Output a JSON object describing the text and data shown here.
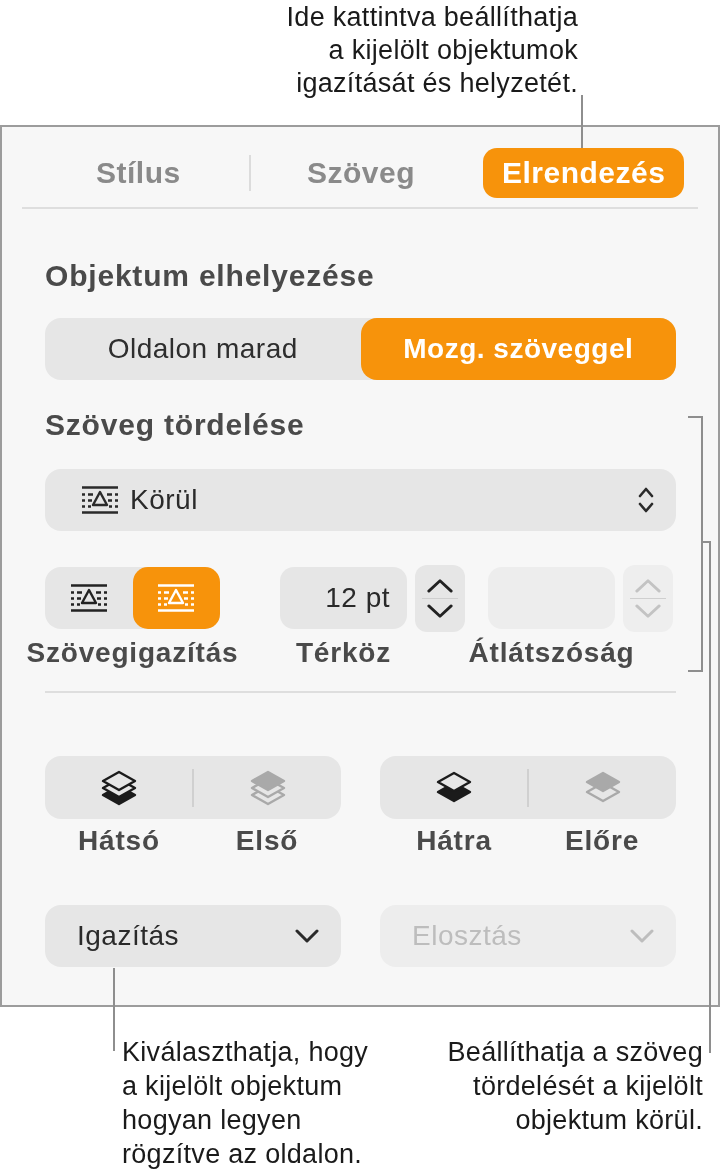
{
  "top_callout": {
    "lines": [
      "Ide kattintva beállíthatja",
      "a kijelölt objektumok",
      "igazítását és helyzetét."
    ]
  },
  "tabs": [
    {
      "label": "Stílus",
      "selected": false
    },
    {
      "label": "Szöveg",
      "selected": false
    },
    {
      "label": "Elrendezés",
      "selected": true
    }
  ],
  "object_placement": {
    "heading": "Objektum elhelyezése",
    "options": [
      {
        "label": "Oldalon marad",
        "selected": false
      },
      {
        "label": "Mozg. szöveggel",
        "selected": true
      }
    ]
  },
  "text_wrap": {
    "heading": "Szöveg tördelése",
    "dropdown": {
      "value": "Körül"
    },
    "alignment": {
      "label": "Szövegigazítás",
      "options": [
        {
          "selected": false
        },
        {
          "selected": true
        }
      ]
    },
    "spacing": {
      "label": "Térköz",
      "value": "12 pt",
      "disabled": false
    },
    "opacity": {
      "label": "Átlátszóság",
      "disabled": true
    }
  },
  "arrange": [
    {
      "buttons": [
        {
          "kind": "to_back",
          "label": "Hátsó",
          "disabled": false
        },
        {
          "kind": "to_front",
          "label": "Első",
          "disabled": true
        }
      ]
    },
    {
      "buttons": [
        {
          "kind": "backward",
          "label": "Hátra",
          "disabled": false
        },
        {
          "kind": "forward",
          "label": "Előre",
          "disabled": true
        }
      ]
    }
  ],
  "dropdowns": [
    {
      "label": "Igazítás",
      "disabled": false
    },
    {
      "label": "Elosztás",
      "disabled": true
    }
  ],
  "left_callout": {
    "lines": [
      "Kiválaszthatja, hogy",
      "a kijelölt objektum",
      "hogyan legyen",
      "rögzítve az oldalon."
    ]
  },
  "right_callout": {
    "lines": [
      "Beállíthatja a szöveg",
      "tördelését a kijelölt",
      "objektum körül."
    ]
  }
}
